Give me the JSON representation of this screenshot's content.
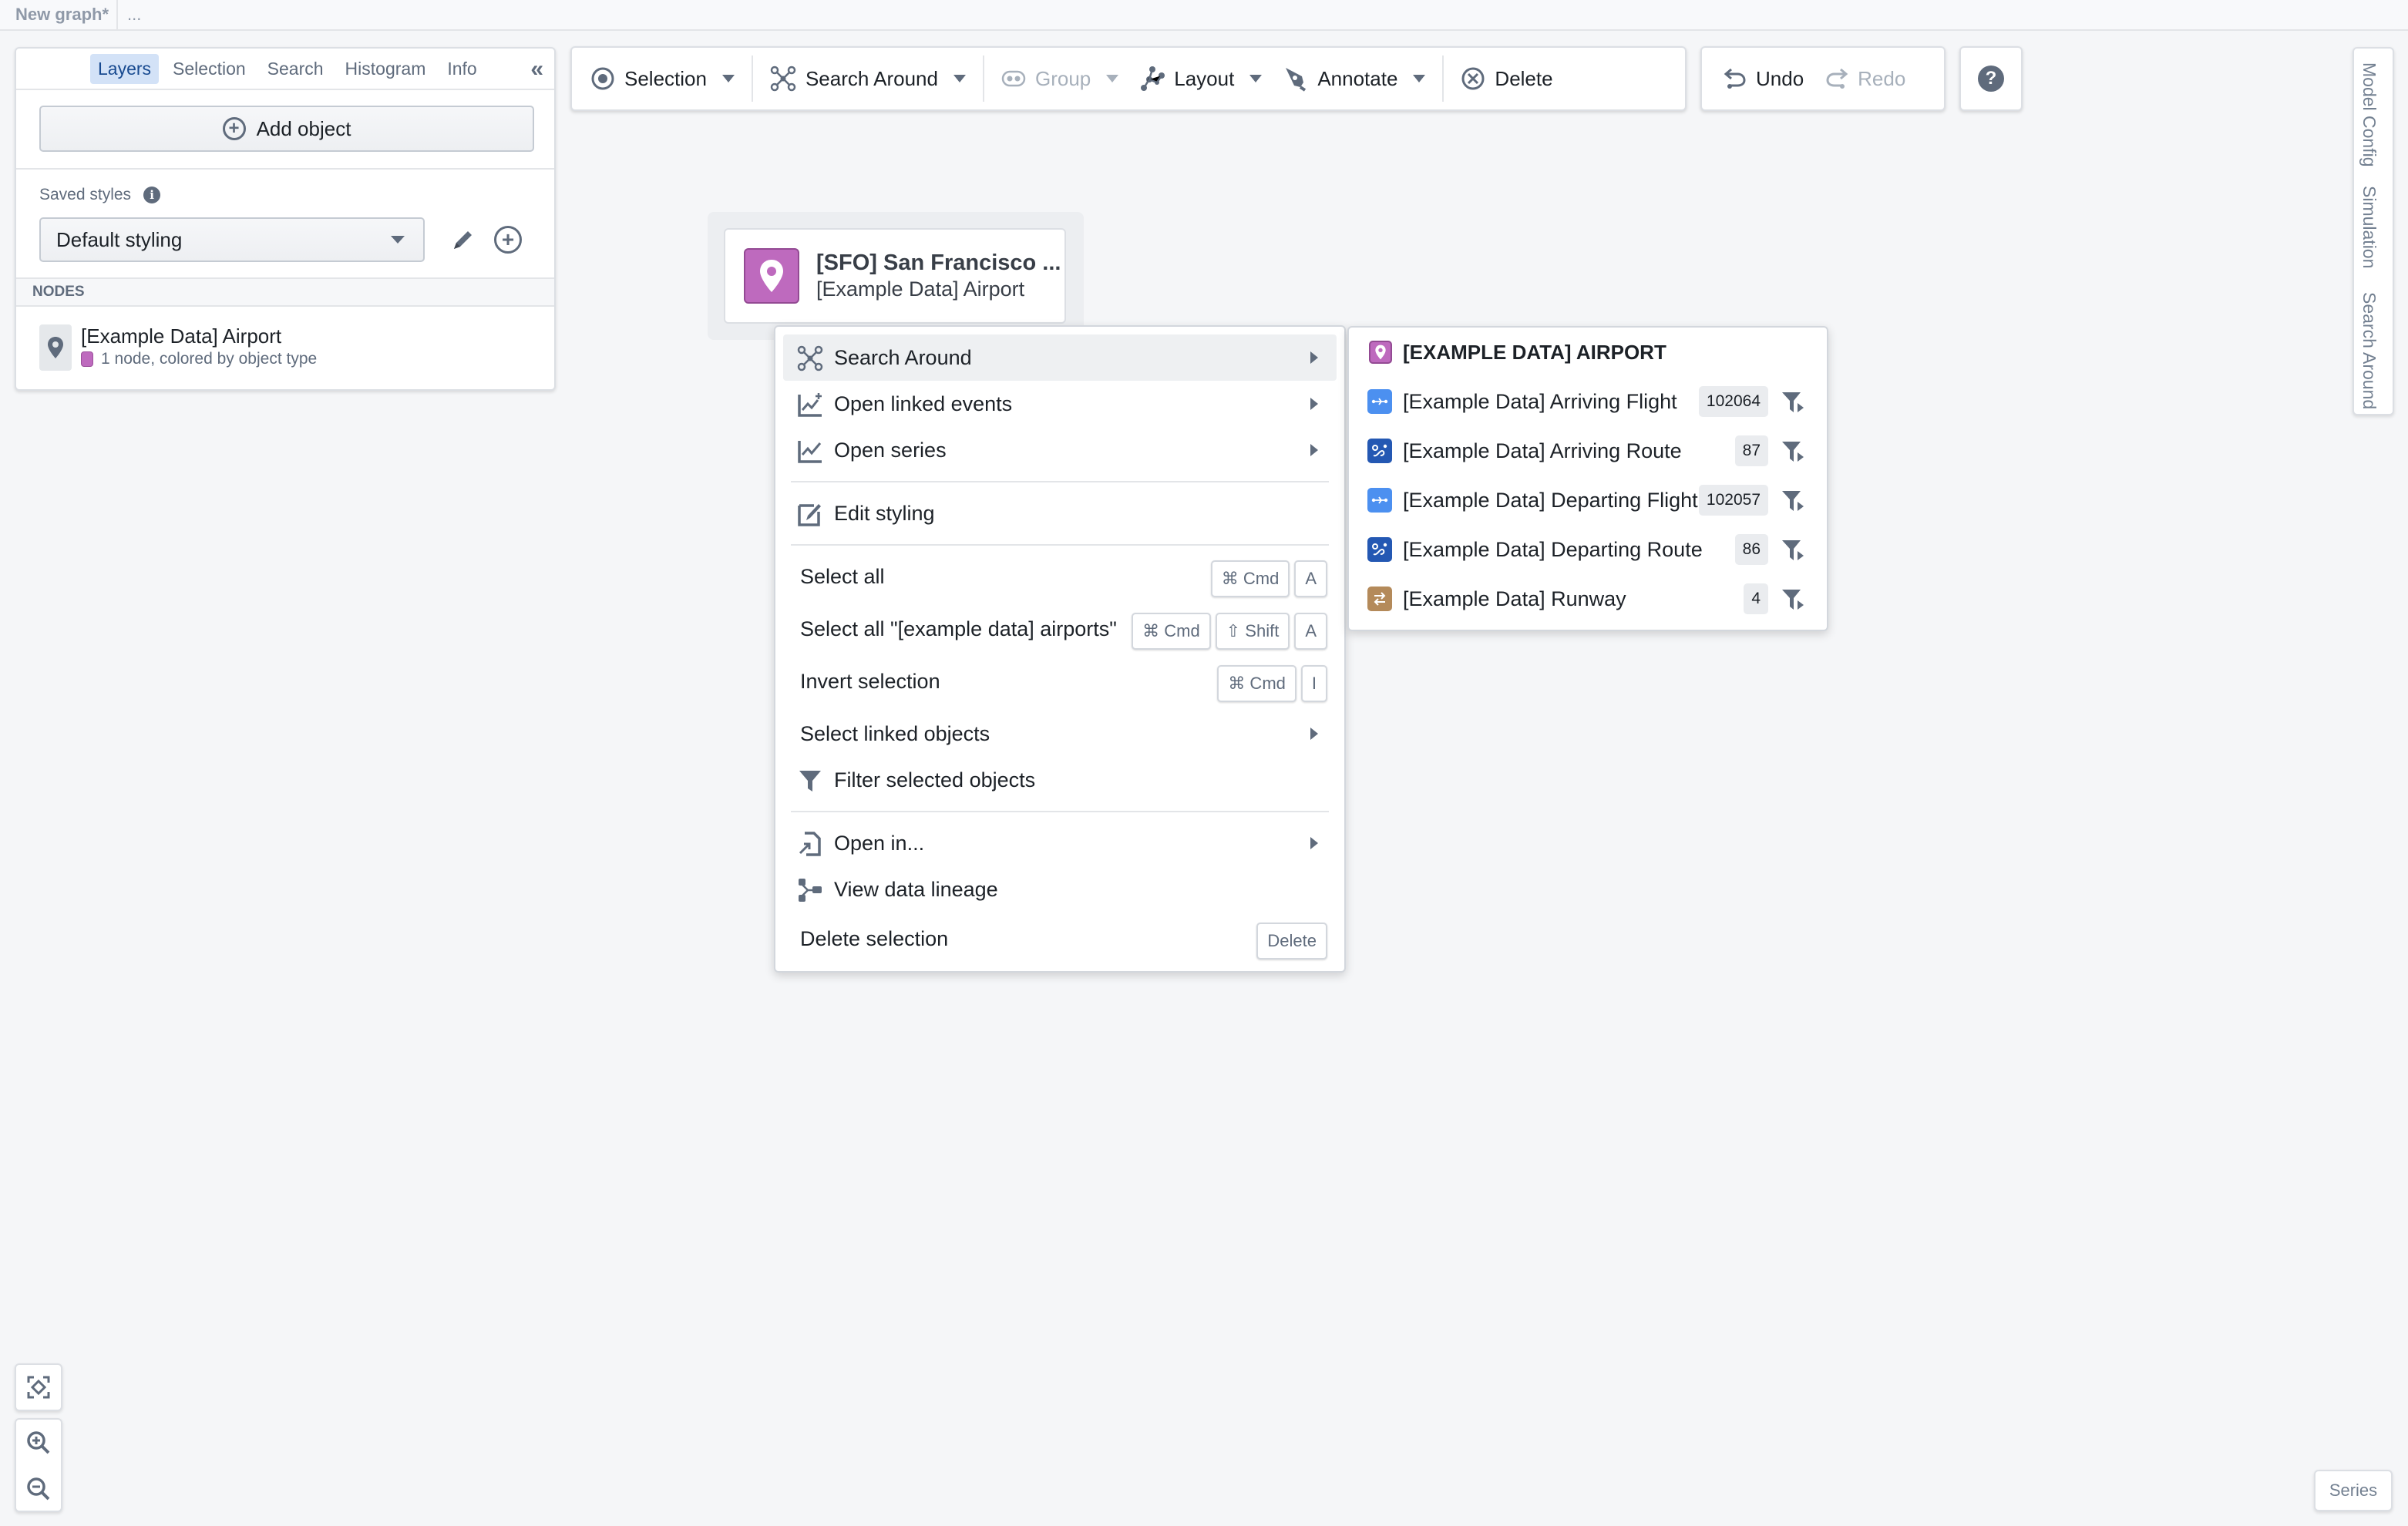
{
  "topbar": {
    "title": "New graph*",
    "more": "..."
  },
  "left_panel": {
    "tabs": [
      {
        "label": "Layers",
        "active": true
      },
      {
        "label": "Selection",
        "active": false
      },
      {
        "label": "Search",
        "active": false
      },
      {
        "label": "Histogram",
        "active": false
      },
      {
        "label": "Info",
        "active": false
      }
    ],
    "collapse_icon": "double-chevron-left",
    "add_object_label": "Add object",
    "saved_styles_label": "Saved styles",
    "saved_styles_value": "Default styling",
    "nodes_header": "NODES",
    "node_layer": {
      "title": "[Example Data] Airport",
      "subtitle": "1 node, colored by object type",
      "color": "#be6abe"
    }
  },
  "toolbar": {
    "selection": "Selection",
    "search_around": "Search Around",
    "group": "Group",
    "layout": "Layout",
    "annotate": "Annotate",
    "delete": "Delete",
    "undo": "Undo",
    "redo": "Redo",
    "help": "?"
  },
  "graph_node": {
    "title": "[SFO] San Francisco ...",
    "subtitle": "[Example Data] Airport",
    "color": "#be6abe"
  },
  "context_menu": {
    "search_around": "Search Around",
    "open_linked_events": "Open linked events",
    "open_series": "Open series",
    "edit_styling": "Edit styling",
    "select_all": "Select all",
    "select_all_type": "Select all \"[example data] airports\"",
    "invert_selection": "Invert selection",
    "select_linked": "Select linked objects",
    "filter_selected": "Filter selected objects",
    "open_in": "Open in...",
    "view_lineage": "View data lineage",
    "delete_selection": "Delete selection",
    "keys": {
      "cmd": "⌘ Cmd",
      "shift": "⇧ Shift",
      "a": "A",
      "i": "I",
      "delete": "Delete"
    }
  },
  "submenu": {
    "header": "[EXAMPLE DATA] AIRPORT",
    "items": [
      {
        "label": "[Example Data] Arriving Flight",
        "count": "102064",
        "color": "#4c90f0"
      },
      {
        "label": "[Example Data] Arriving Route",
        "count": "87",
        "color": "#2458b3"
      },
      {
        "label": "[Example Data] Departing Flight",
        "count": "102057",
        "color": "#4c90f0"
      },
      {
        "label": "[Example Data] Departing Route",
        "count": "86",
        "color": "#2458b3"
      },
      {
        "label": "[Example Data] Runway",
        "count": "4",
        "color": "#b48a5a"
      }
    ]
  },
  "right_tabs": [
    "Model Config",
    "Simulation",
    "Search Around"
  ],
  "series_label": "Series"
}
